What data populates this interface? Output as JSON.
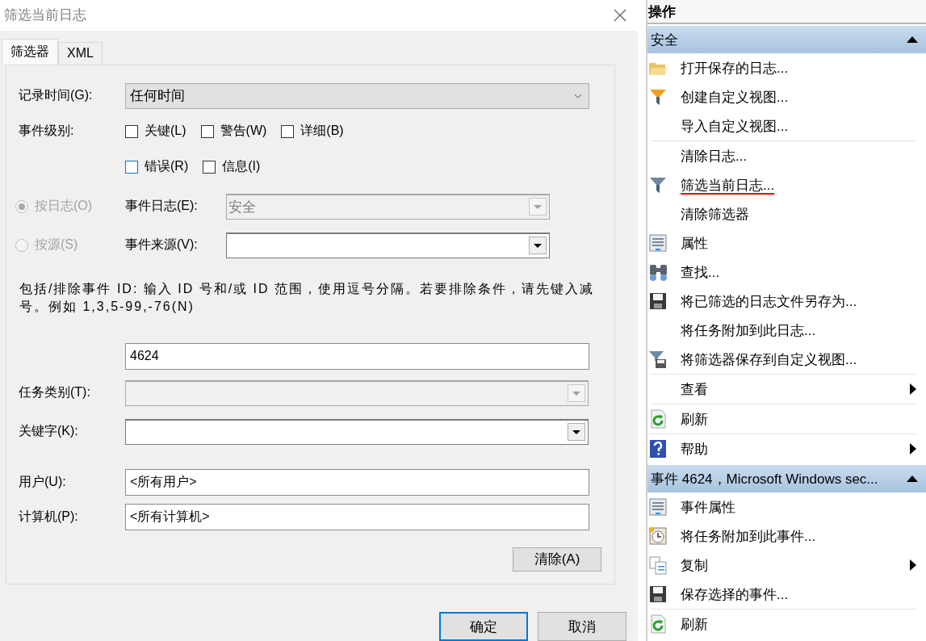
{
  "dialog": {
    "title": "筛选当前日志",
    "tabs": [
      {
        "label": "筛选器",
        "selected": true
      },
      {
        "label": "XML",
        "selected": false
      }
    ],
    "logged": {
      "label": "记录时间(G):",
      "value": "任何时间"
    },
    "event_level": {
      "label": "事件级别:",
      "rows": [
        [
          {
            "label": "关键(L)",
            "checked": false,
            "focused": false
          },
          {
            "label": "警告(W)",
            "checked": false,
            "focused": false
          },
          {
            "label": "详细(B)",
            "checked": false,
            "focused": false
          }
        ],
        [
          {
            "label": "错误(R)",
            "checked": false,
            "focused": true
          },
          {
            "label": "信息(I)",
            "checked": false,
            "focused": false
          }
        ]
      ]
    },
    "source_modes": [
      {
        "label": "按日志(O)",
        "selected": true,
        "disabled": true,
        "field_label": "事件日志(E):",
        "field_value": "安全",
        "field_disabled": true
      },
      {
        "label": "按源(S)",
        "selected": false,
        "disabled": true,
        "field_label": "事件来源(V):",
        "field_disabled": false
      }
    ],
    "description": "包括/排除事件 ID: 输入 ID 号和/或 ID 范围，使用逗号分隔。若要排除条件，请先键入减号。例如 1,3,5-99,-76(N)",
    "event_ids": {
      "value": "4624"
    },
    "task_category": {
      "label": "任务类别(T):",
      "disabled": true
    },
    "keywords": {
      "label": "关键字(K):",
      "disabled": false
    },
    "user": {
      "label": "用户(U):",
      "value": "<所有用户>"
    },
    "computer": {
      "label": "计算机(P):",
      "value": "<所有计算机>"
    },
    "clear_button": "清除(A)",
    "buttons": [
      {
        "label": "确定",
        "default": true
      },
      {
        "label": "取消",
        "default": false
      }
    ]
  },
  "actions": {
    "title": "操作",
    "groups": [
      {
        "title": "安全",
        "expanded": true,
        "sections": [
          {
            "items": [
              {
                "label": "打开保存的日志...",
                "kind": "folder",
                "submenu": false,
                "underlined": false
              },
              {
                "label": "创建自定义视图...",
                "kind": "funnel-color",
                "submenu": false,
                "underlined": false
              },
              {
                "label": "导入自定义视图...",
                "kind": "plain",
                "submenu": false,
                "underlined": false
              }
            ]
          },
          {
            "items": [
              {
                "label": "清除日志...",
                "kind": "plain",
                "submenu": false,
                "underlined": false
              },
              {
                "label": "筛选当前日志...",
                "kind": "funnel",
                "submenu": false,
                "underlined": true
              },
              {
                "label": "清除筛选器",
                "kind": "plain",
                "submenu": false,
                "underlined": false
              },
              {
                "label": "属性",
                "kind": "properties",
                "submenu": false,
                "underlined": false
              },
              {
                "label": "查找...",
                "kind": "binoculars",
                "submenu": false,
                "underlined": false
              },
              {
                "label": "将已筛选的日志文件另存为...",
                "kind": "floppy",
                "submenu": false,
                "underlined": false
              },
              {
                "label": "将任务附加到此日志...",
                "kind": "plain",
                "submenu": false,
                "underlined": false
              },
              {
                "label": "将筛选器保存到自定义视图...",
                "kind": "funnel-save",
                "submenu": false,
                "underlined": false
              }
            ]
          },
          {
            "items": [
              {
                "label": "查看",
                "kind": "plain",
                "submenu": true,
                "underlined": false
              }
            ]
          },
          {
            "items": [
              {
                "label": "刷新",
                "kind": "refresh",
                "submenu": false,
                "underlined": false
              }
            ]
          },
          {
            "items": [
              {
                "label": "帮助",
                "kind": "help",
                "submenu": true,
                "underlined": false
              }
            ]
          }
        ]
      },
      {
        "title": "事件 4624，Microsoft Windows sec...",
        "expanded": true,
        "sections": [
          {
            "items": [
              {
                "label": "事件属性",
                "kind": "properties",
                "submenu": false,
                "underlined": false
              },
              {
                "label": "将任务附加到此事件...",
                "kind": "clock",
                "submenu": false,
                "underlined": false
              },
              {
                "label": "复制",
                "kind": "copy",
                "submenu": true,
                "underlined": false
              },
              {
                "label": "保存选择的事件...",
                "kind": "floppy",
                "submenu": false,
                "underlined": false
              }
            ]
          },
          {
            "items": [
              {
                "label": "刷新",
                "kind": "refresh",
                "submenu": false,
                "underlined": false
              }
            ]
          }
        ]
      }
    ]
  }
}
